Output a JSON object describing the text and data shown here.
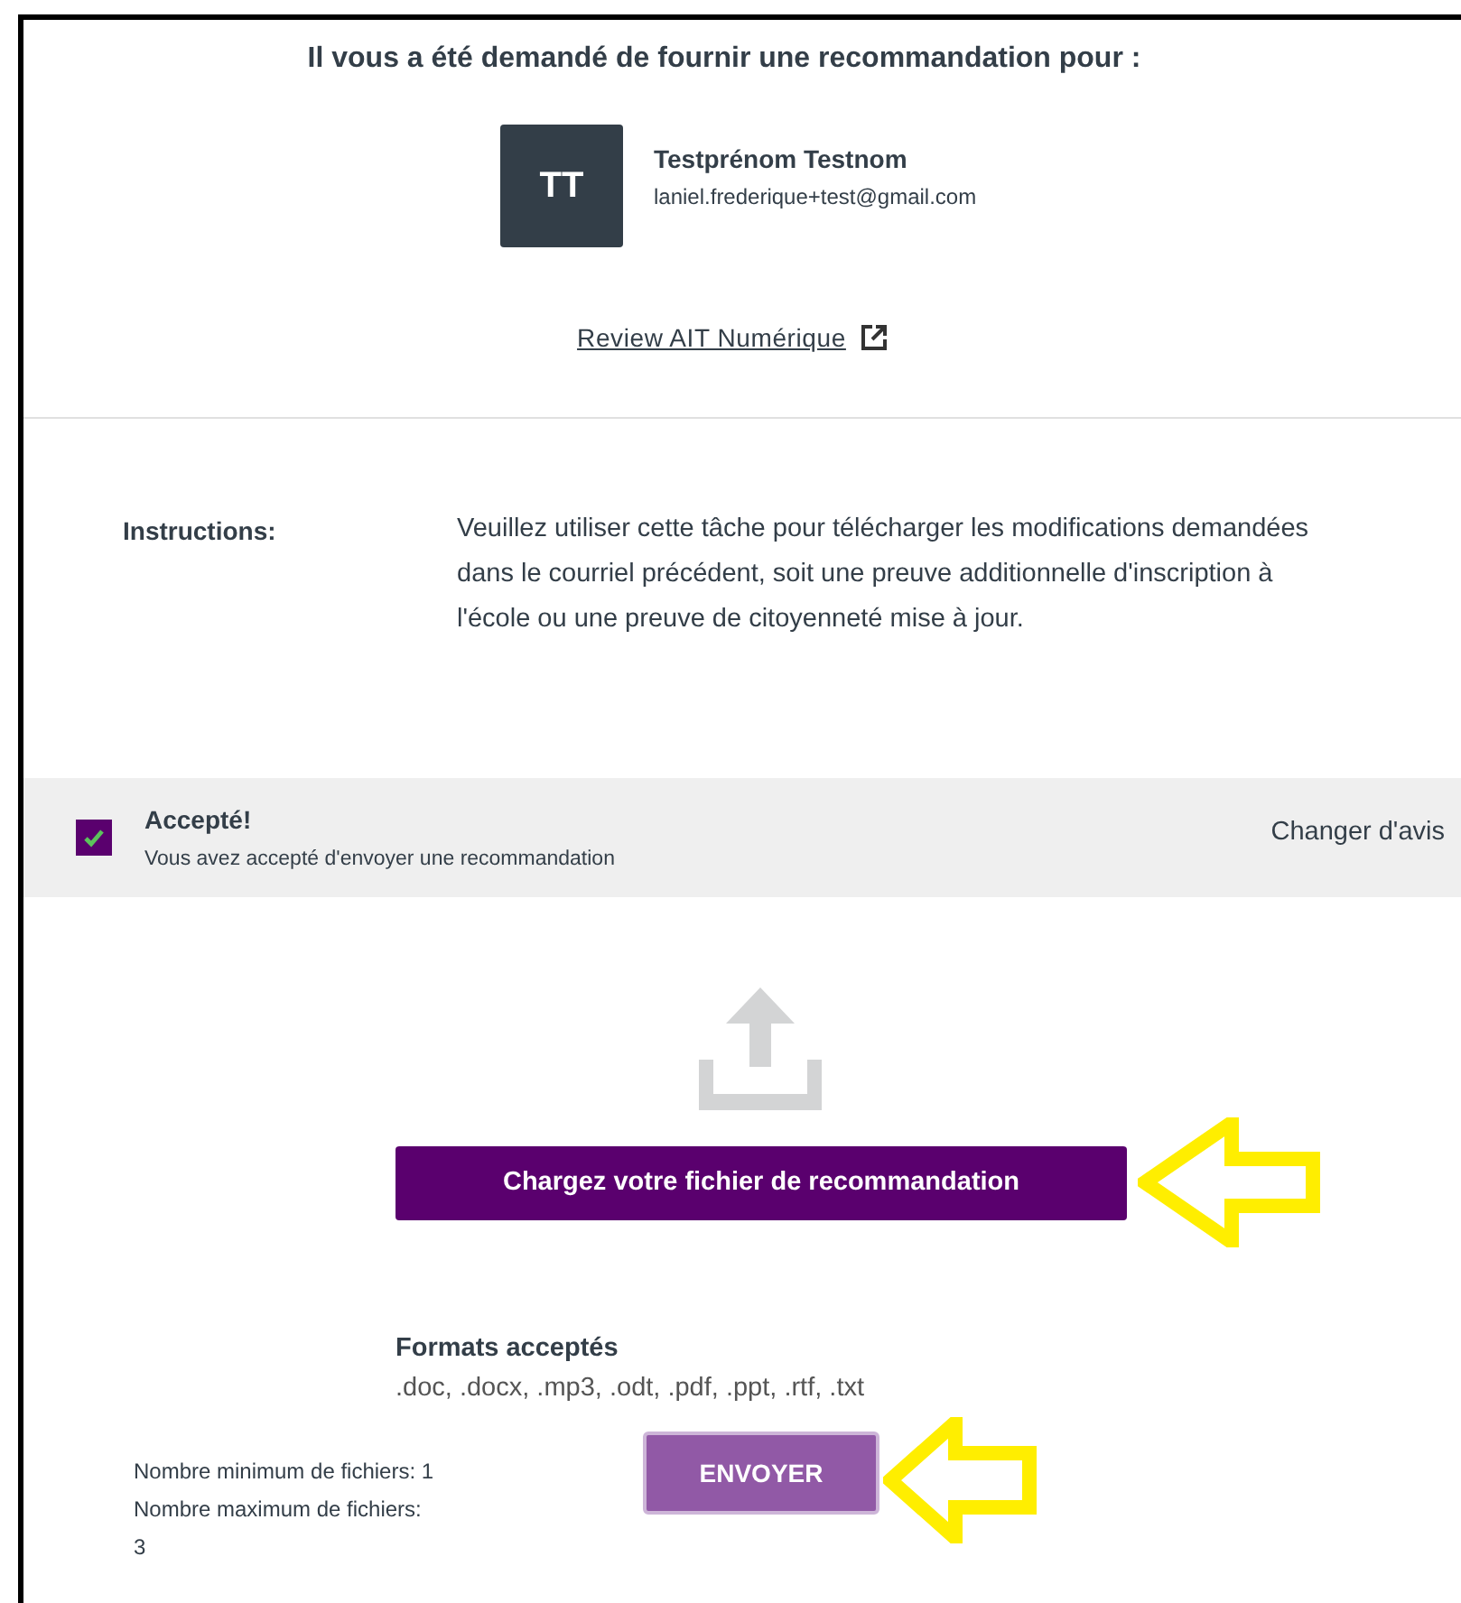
{
  "heading": "Il vous a été demandé de fournir une recommandation pour :",
  "person": {
    "initials": "TT",
    "name": "Testprénom Testnom",
    "email": "laniel.frederique+test@gmail.com"
  },
  "link": {
    "label": "Review AIT Numérique"
  },
  "instructions": {
    "label": "Instructions:",
    "text": "Veuillez utiliser cette tâche pour télécharger les modifications demandées dans le courriel précédent, soit une preuve additionnelle d'inscription à l'école ou une preuve de citoyenneté mise à jour."
  },
  "acceptance": {
    "checked": true,
    "title": "Accepté!",
    "subtitle": "Vous avez accepté d'envoyer une recommandation",
    "change_label": "Changer d'avis"
  },
  "upload_button": "Chargez votre fichier de recommandation",
  "formats": {
    "title": "Formats acceptés",
    "list": ".doc, .docx, .mp3, .odt, .pdf, .ppt, .rtf, .txt"
  },
  "limits": [
    "Nombre minimum de fichiers: 1",
    "Nombre maximum de fichiers:",
    "3"
  ],
  "submit_button": "ENVOYER"
}
